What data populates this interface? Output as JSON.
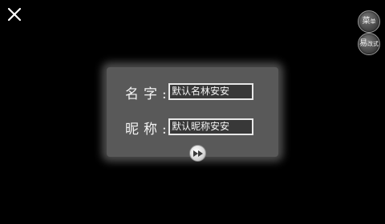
{
  "topbar": {
    "close_icon": "close-icon"
  },
  "side_buttons": {
    "menu_big": "菜",
    "menu_small": "单",
    "easy_big": "易",
    "easy_small": "改式"
  },
  "dialog": {
    "name_label": "名字:",
    "name_value": "默认名林安安",
    "nickname_label": "昵称:",
    "nickname_value": "默认昵称安安",
    "next_icon": "fast-forward-icon"
  },
  "colors": {
    "background": "#000000",
    "panel": "#595959",
    "field_border": "#e8e8e8",
    "text": "#f4f4f4"
  }
}
